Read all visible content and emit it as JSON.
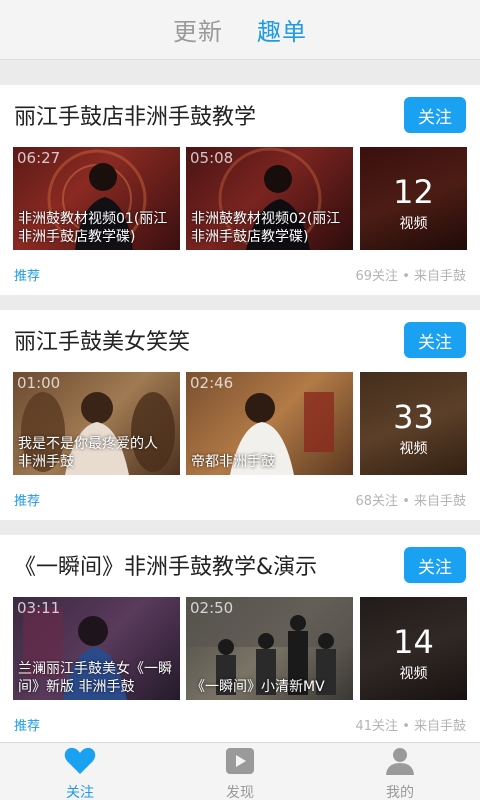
{
  "top_tabs": [
    {
      "label": "更新",
      "active": false
    },
    {
      "label": "趣单",
      "active": true
    }
  ],
  "cards": [
    {
      "title": "丽江手鼓店非洲手鼓教学",
      "follow_label": "关注",
      "videos": [
        {
          "duration": "06:27",
          "caption": "非洲鼓教材视频01(丽江非洲手鼓店教学碟)"
        },
        {
          "duration": "05:08",
          "caption": "非洲鼓教材视频02(丽江非洲手鼓店教学碟)"
        }
      ],
      "count": {
        "number": "12",
        "label": "视频"
      },
      "tag": "推荐",
      "meta": "69关注 • 来自手鼓"
    },
    {
      "title": "丽江手鼓美女笑笑",
      "follow_label": "关注",
      "videos": [
        {
          "duration": "01:00",
          "caption": "我是不是你最疼爱的人 非洲手鼓"
        },
        {
          "duration": "02:46",
          "caption": "帝都非洲手鼓"
        }
      ],
      "count": {
        "number": "33",
        "label": "视频"
      },
      "tag": "推荐",
      "meta": "68关注 • 来自手鼓"
    },
    {
      "title": "《一瞬间》非洲手鼓教学&演示",
      "follow_label": "关注",
      "videos": [
        {
          "duration": "03:11",
          "caption": "兰澜丽江手鼓美女《一瞬间》新版 非洲手鼓"
        },
        {
          "duration": "02:50",
          "caption": "《一瞬间》小清新MV"
        }
      ],
      "count": {
        "number": "14",
        "label": "视频"
      },
      "tag": "推荐",
      "meta": "41关注 • 来自手鼓"
    }
  ],
  "bottom_nav": [
    {
      "label": "关注",
      "icon": "heart-icon",
      "active": true
    },
    {
      "label": "发现",
      "icon": "play-icon",
      "active": false
    },
    {
      "label": "我的",
      "icon": "person-icon",
      "active": false
    }
  ],
  "colors": {
    "accent": "#1aa1f2",
    "inactive": "#9a9a9a"
  }
}
